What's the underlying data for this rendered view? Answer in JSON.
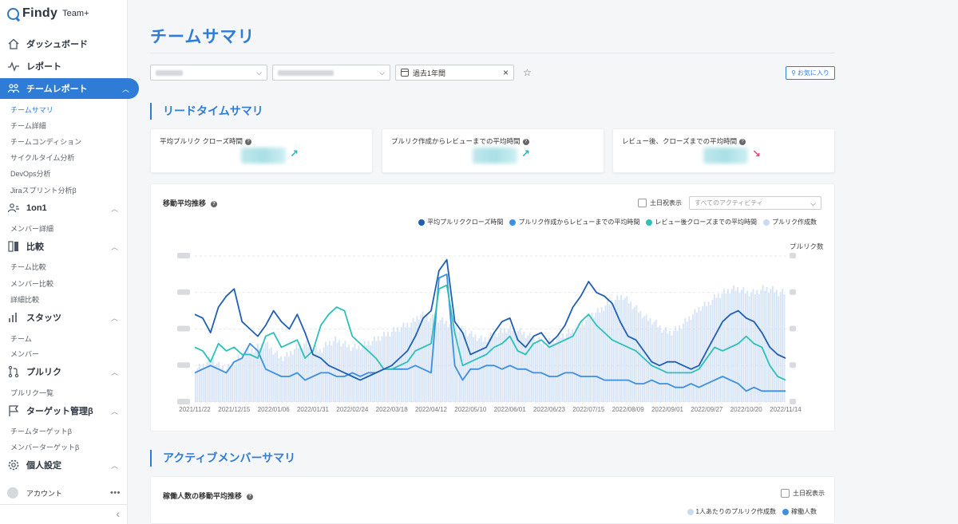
{
  "brand": {
    "name": "Findy",
    "product": "Team+"
  },
  "sidebar": {
    "main_items": [
      {
        "label": "ダッシュボード",
        "icon": "home-icon"
      },
      {
        "label": "レポート",
        "icon": "pulse-icon"
      },
      {
        "label": "チームレポート",
        "icon": "team-icon",
        "active": true
      },
      {
        "label": "1on1",
        "icon": "people-icon"
      },
      {
        "label": "比較",
        "icon": "compare-icon"
      },
      {
        "label": "スタッツ",
        "icon": "bars-icon"
      },
      {
        "label": "プルリク",
        "icon": "pull-request-icon"
      },
      {
        "label": "ターゲット管理β",
        "icon": "flag-icon"
      },
      {
        "label": "個人設定",
        "icon": "gear-icon"
      }
    ],
    "sub_items": {
      "team_report": [
        "チームサマリ",
        "チーム詳細",
        "チームコンディション",
        "サイクルタイム分析",
        "DevOps分析",
        "Jiraスプリント分析β"
      ],
      "one_on_one": [
        "メンバー詳細"
      ],
      "compare": [
        "チーム比較",
        "メンバー比較",
        "詳細比較"
      ],
      "stats": [
        "チーム",
        "メンバー"
      ],
      "pull_request": [
        "プルリク一覧"
      ],
      "target": [
        "チームターゲットβ",
        "メンバーターゲットβ"
      ]
    },
    "account_label": "アカウント"
  },
  "main": {
    "title": "チームサマリ",
    "filters": {
      "date_range": "過去1年間",
      "favorite_label": "お気に入り"
    },
    "lead_time_section": "リードタイムサマリ",
    "kpis": [
      {
        "label": "平均プルリク クローズ時間",
        "trend": "up",
        "trend_color": "#1db7bf"
      },
      {
        "label": "プルリク作成からレビューまでの平均時間",
        "trend": "up",
        "trend_color": "#1db7bf"
      },
      {
        "label": "レビュー後、クローズまでの平均時間",
        "trend": "down",
        "trend_color": "#e6467f"
      }
    ],
    "trend_chart": {
      "title": "移動平均推移",
      "weekend_checkbox": "土日祝表示",
      "activity_placeholder": "すべてのアクティビティ",
      "right_axis_label": "プルリク数"
    },
    "active_section": "アクティブメンバーサマリ",
    "active_card": {
      "title": "稼働人数の移動平均推移",
      "weekend_checkbox": "土日祝表示",
      "legend": [
        "1人あたりのプルリク作成数",
        "稼働人数"
      ]
    }
  },
  "colors": {
    "accent": "#2e7cd6",
    "series1": "#1f5fb3",
    "series2": "#3d8fe0",
    "series3": "#2cc0b8",
    "bars": "#c9dbf2"
  },
  "chart_data": {
    "type": "line",
    "title": "移動平均推移",
    "right_ylabel": "プルリク数",
    "x_ticks": [
      "2021/11/22",
      "2021/12/15",
      "2022/01/06",
      "2022/01/31",
      "2022/02/24",
      "2022/03/18",
      "2022/04/12",
      "2022/05/10",
      "2022/06/01",
      "2022/06/23",
      "2022/07/15",
      "2022/08/09",
      "2022/09/01",
      "2022/09/27",
      "2022/10/20",
      "2022/11/14"
    ],
    "series": [
      {
        "name": "平均プルリククローズ時間",
        "color": "#1f5fb3",
        "values": [
          2.4,
          2.3,
          1.9,
          2.6,
          2.9,
          3.1,
          2.2,
          2.0,
          1.8,
          2.1,
          2.5,
          2.2,
          2.0,
          2.4,
          1.9,
          1.3,
          1.2,
          1.0,
          0.9,
          0.8,
          0.7,
          0.6,
          0.7,
          0.8,
          0.9,
          1.0,
          1.2,
          1.4,
          1.8,
          2.3,
          2.5,
          3.6,
          3.9,
          2.2,
          1.9,
          1.3,
          1.4,
          1.5,
          1.9,
          2.2,
          2.3,
          1.7,
          1.5,
          1.8,
          1.9,
          1.6,
          1.8,
          2.1,
          2.6,
          2.9,
          3.3,
          3.0,
          2.9,
          2.7,
          2.2,
          1.8,
          1.7,
          1.4,
          1.1,
          1.0,
          1.1,
          1.1,
          1.0,
          0.9,
          1.0,
          1.4,
          1.8,
          2.2,
          2.4,
          2.5,
          2.3,
          2.2,
          1.9,
          1.5,
          1.3,
          1.2
        ]
      },
      {
        "name": "プルリク作成からレビューまでの平均時間",
        "color": "#3d8fe0",
        "values": [
          0.8,
          0.9,
          1.0,
          0.9,
          0.8,
          1.1,
          1.2,
          1.6,
          1.4,
          0.9,
          0.8,
          0.7,
          0.7,
          0.8,
          0.6,
          0.7,
          0.8,
          0.8,
          0.7,
          0.7,
          0.8,
          0.7,
          0.8,
          0.8,
          0.9,
          0.9,
          0.9,
          0.9,
          1.0,
          0.9,
          0.8,
          3.4,
          3.5,
          1.0,
          0.6,
          0.9,
          0.9,
          1.0,
          1.0,
          0.9,
          1.0,
          0.9,
          0.9,
          0.8,
          0.8,
          0.7,
          0.7,
          0.8,
          0.8,
          0.7,
          0.7,
          0.7,
          0.6,
          0.6,
          0.6,
          0.6,
          0.5,
          0.5,
          0.6,
          0.5,
          0.5,
          0.4,
          0.4,
          0.5,
          0.4,
          0.5,
          0.6,
          0.7,
          0.6,
          0.5,
          0.3,
          0.4,
          0.3,
          0.3,
          0.3,
          0.3
        ]
      },
      {
        "name": "レビュー後クローズまでの平均時間",
        "color": "#2cc0b8",
        "values": [
          1.5,
          1.4,
          1.1,
          1.6,
          1.4,
          1.5,
          1.3,
          1.3,
          1.2,
          1.8,
          1.9,
          1.5,
          1.6,
          1.7,
          1.2,
          1.4,
          2.1,
          2.4,
          2.6,
          2.5,
          1.8,
          1.6,
          1.4,
          1.2,
          0.9,
          0.9,
          1.0,
          1.1,
          1.4,
          1.5,
          1.6,
          3.1,
          3.2,
          1.9,
          1.0,
          1.1,
          1.2,
          1.3,
          1.5,
          1.6,
          1.8,
          1.4,
          1.3,
          1.6,
          1.7,
          1.5,
          1.6,
          1.7,
          1.8,
          2.2,
          2.4,
          2.1,
          1.9,
          1.7,
          1.6,
          1.5,
          1.4,
          1.2,
          1.0,
          0.9,
          0.8,
          0.8,
          0.8,
          0.8,
          0.9,
          1.2,
          1.5,
          1.4,
          1.5,
          1.6,
          1.8,
          1.6,
          1.5,
          1.0,
          0.7,
          0.6
        ]
      },
      {
        "name": "プルリク作成数",
        "color": "#c9dbf2",
        "type": "bar",
        "values": [
          0.9,
          1.0,
          1.2,
          1.0,
          0.9,
          1.1,
          1.3,
          1.4,
          1.5,
          1.6,
          1.4,
          1.2,
          1.3,
          1.5,
          1.6,
          1.5,
          1.4,
          1.6,
          1.7,
          1.6,
          1.5,
          1.5,
          1.6,
          1.7,
          1.8,
          1.9,
          2.0,
          2.1,
          2.2,
          2.4,
          2.3,
          2.3,
          2.2,
          2.1,
          2.0,
          1.9,
          1.8,
          1.7,
          1.8,
          1.9,
          2.0,
          2.0,
          1.9,
          1.8,
          1.7,
          1.6,
          1.7,
          1.8,
          1.9,
          2.0,
          2.2,
          2.4,
          2.5,
          2.7,
          2.8,
          2.9,
          2.7,
          2.5,
          2.3,
          2.2,
          2.0,
          1.9,
          2.0,
          2.2,
          2.4,
          2.6,
          2.7,
          2.9,
          3.0,
          3.1,
          3.1,
          3.0,
          3.0,
          3.1,
          3.1,
          3.0
        ]
      }
    ]
  }
}
